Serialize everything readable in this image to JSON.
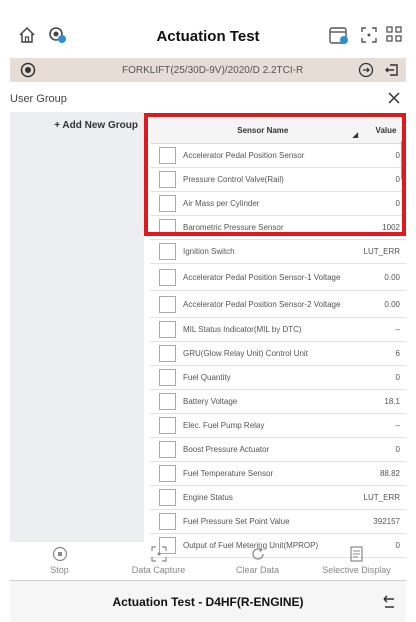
{
  "header": {
    "title": "Actuation Test"
  },
  "vehicle": {
    "label": "FORKLIFT(25/30D-9V)/2020/D 2.2TCI-R"
  },
  "group": {
    "label": "User Group",
    "add_label": "+ Add New Group"
  },
  "table": {
    "col_name": "Sensor Name",
    "col_value": "Value",
    "rows": [
      {
        "name": "Accelerator Pedal Position Sensor",
        "value": "0"
      },
      {
        "name": "Pressure Control Valve(Rail)",
        "value": "0"
      },
      {
        "name": "Air Mass per Cylinder",
        "value": "0"
      },
      {
        "name": "Barometric Pressure Sensor",
        "value": "1002"
      },
      {
        "name": "Ignition Switch",
        "value": "LUT_ERR"
      },
      {
        "name": "Accelerator Pedal Position Sensor-1 Voltage",
        "value": "0.00"
      },
      {
        "name": "Accelerator Pedal Position Sensor-2 Voltage",
        "value": "0.00"
      },
      {
        "name": "MIL Status Indicator(MIL by DTC)",
        "value": "–"
      },
      {
        "name": "GRU(Glow Relay Unit) Control Unit",
        "value": "6"
      },
      {
        "name": "Fuel Quantity",
        "value": "0"
      },
      {
        "name": "Battery Voltage",
        "value": "18.1"
      },
      {
        "name": "Elec. Fuel Pump Relay",
        "value": "–"
      },
      {
        "name": "Boost Pressure Actuator",
        "value": "0"
      },
      {
        "name": "Fuel Temperature Sensor",
        "value": "88.82"
      },
      {
        "name": "Engine Status",
        "value": "LUT_ERR"
      },
      {
        "name": "Fuel Pressure Set Point Value",
        "value": "392157"
      },
      {
        "name": "Output of Fuel Metering Unit(MPROP)",
        "value": "0"
      }
    ]
  },
  "tools": {
    "stop": "Stop",
    "capture": "Data Capture",
    "clear": "Clear Data",
    "selective": "Selective Display"
  },
  "footer": {
    "label": "Actuation Test  - D4HF(R-ENGINE)"
  }
}
